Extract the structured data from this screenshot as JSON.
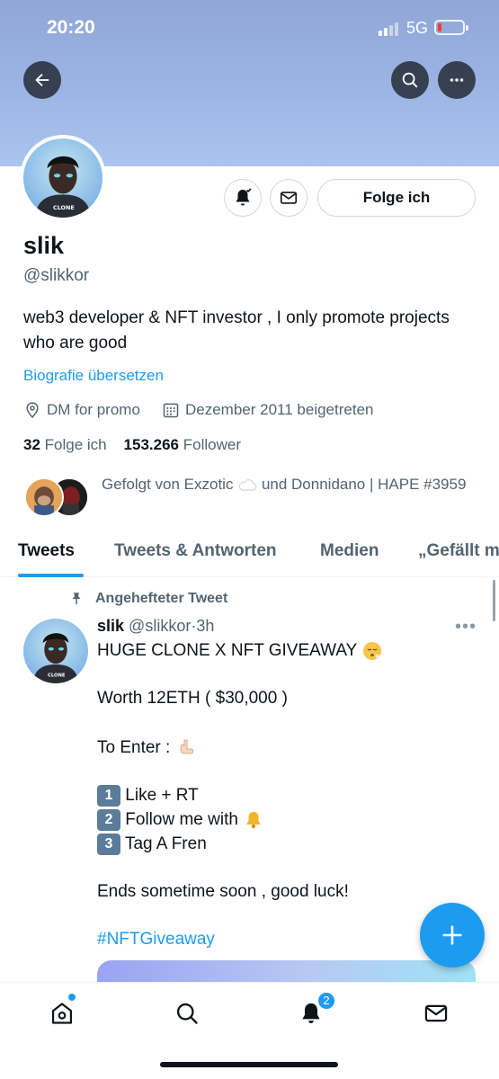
{
  "status_bar": {
    "time": "20:20",
    "network": "5G"
  },
  "profile": {
    "name": "slik",
    "handle": "@slikkor",
    "bio": "web3 developer & NFT investor , I only promote projects who are good",
    "translate_bio": "Biografie übersetzen",
    "location": "DM for promo",
    "joined": "Dezember 2011 beigetreten",
    "following_count": "32",
    "following_label": "Folge ich",
    "followers_count": "153.266",
    "followers_label": "Follower",
    "follow_button": "Folge ich",
    "followed_by_prefix": "Gefolgt von Exzotic",
    "followed_by_suffix": "und Donnidano | HAPE #3959"
  },
  "tabs": [
    "Tweets",
    "Tweets & Antworten",
    "Medien",
    "„Gefällt mir“"
  ],
  "active_tab": "Tweets",
  "tweet": {
    "pinned_label": "Angehefteter Tweet",
    "author_name": "slik",
    "author_handle": "@slikkor",
    "time": "3h",
    "lines": {
      "line1": "HUGE CLONE X NFT GIVEAWAY",
      "line2": "Worth 12ETH ( $30,000 )",
      "line3": "To Enter :",
      "step1": "Like + RT",
      "step2": "Follow me with",
      "step3": "Tag A Fren",
      "line4": "Ends sometime soon , good luck!",
      "hashtag": "#NFTGiveaway"
    },
    "step_numbers": [
      "1",
      "2",
      "3"
    ]
  },
  "bottom_nav": {
    "notifications_badge": "2"
  },
  "colors": {
    "accent": "#1d9bf0",
    "banner": "#9db5e4",
    "text": "#0f1419",
    "secondary": "#536471"
  },
  "icons": [
    "back-arrow-icon",
    "search-icon",
    "more-icon",
    "bell-icon",
    "mail-icon",
    "location-icon",
    "calendar-icon",
    "pin-icon",
    "plus-icon",
    "home-icon",
    "cloud-icon",
    "battery-icon",
    "signal-icon"
  ]
}
